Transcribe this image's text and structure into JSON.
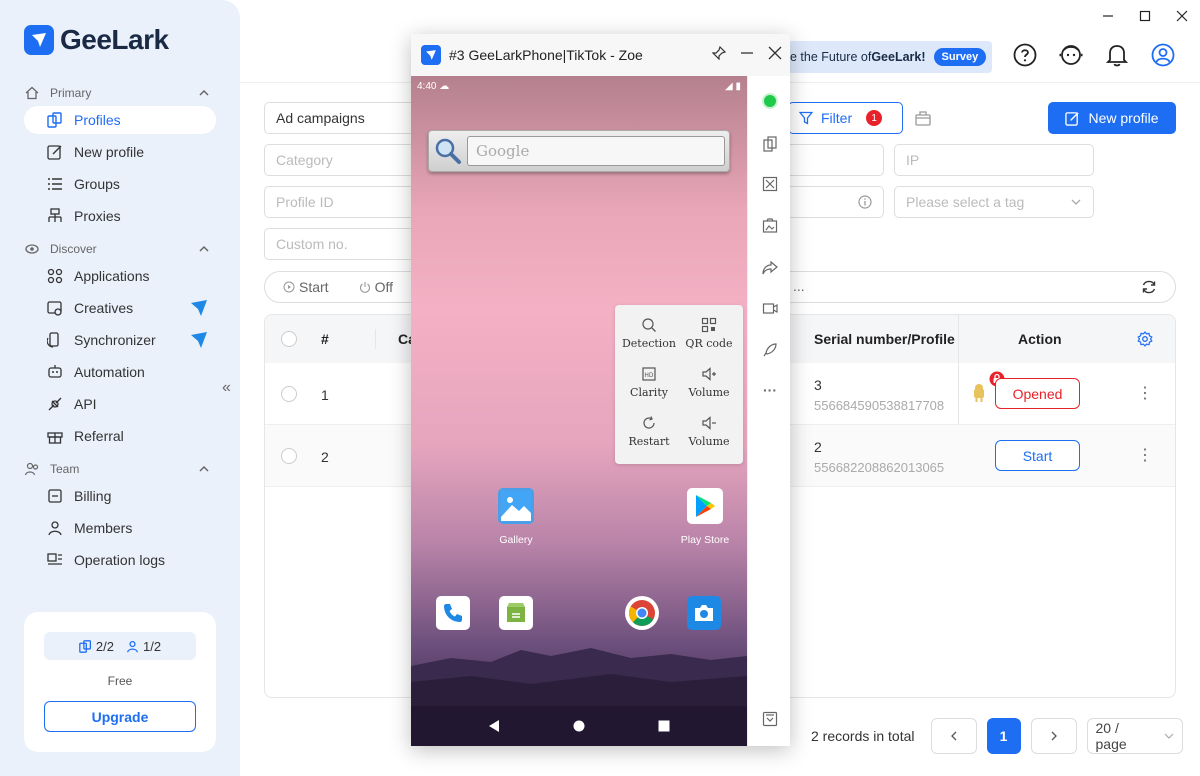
{
  "brand": {
    "name": "GeeLark"
  },
  "sidebar": {
    "sections": [
      {
        "label": "Primary"
      },
      {
        "label": "Discover"
      },
      {
        "label": "Team"
      }
    ],
    "items": [
      {
        "label": "Profiles",
        "icon": "profiles-icon",
        "active": true
      },
      {
        "label": "New profile",
        "icon": "edit-icon"
      },
      {
        "label": "Groups",
        "icon": "list-icon"
      },
      {
        "label": "Proxies",
        "icon": "network-icon"
      },
      {
        "label": "Applications",
        "icon": "grid-icon"
      },
      {
        "label": "Creatives",
        "icon": "creatives-icon"
      },
      {
        "label": "Synchronizer",
        "icon": "sync-icon"
      },
      {
        "label": "Automation",
        "icon": "robot-icon"
      },
      {
        "label": "API",
        "icon": "api-icon"
      },
      {
        "label": "Referral",
        "icon": "gift-icon"
      },
      {
        "label": "Billing",
        "icon": "billing-icon"
      },
      {
        "label": "Members",
        "icon": "person-icon"
      },
      {
        "label": "Operation logs",
        "icon": "logs-icon"
      }
    ],
    "plan": {
      "profiles": "2/2",
      "members": "1/2",
      "name": "Free",
      "upgrade_label": "Upgrade"
    }
  },
  "topbar": {
    "survey_text_pre": "e the Future of ",
    "survey_text_bold": "GeeLark!",
    "survey_button": "Survey"
  },
  "filters": {
    "ad_campaigns": "Ad campaigns",
    "category_placeholder": "Category",
    "profile_id_placeholder": "Profile ID",
    "custom_no_placeholder": "Custom no.",
    "ip_placeholder": "IP",
    "tag_placeholder": "Please select a tag",
    "filter_label": "Filter",
    "filter_count": "1",
    "new_profile_label": "New profile",
    "status_start": "Start",
    "status_off": "Off",
    "status_more": "..."
  },
  "table": {
    "headers": {
      "index": "#",
      "category_partial": "Ca",
      "serial": "Serial number/Profile",
      "action": "Action"
    },
    "rows": [
      {
        "index": "1",
        "serial": "3",
        "profile_id": "556684590538817708",
        "action": "Opened"
      },
      {
        "index": "2",
        "serial": "2",
        "profile_id": "556682208862013065",
        "action": "Start"
      }
    ]
  },
  "pagination": {
    "total": "2 records in total",
    "current": "1",
    "page_size": "20 / page"
  },
  "phone_window": {
    "title": "#3 GeeLarkPhone|TikTok - Zoe",
    "time": "4:40",
    "search_placeholder": "Google",
    "popup": [
      {
        "label": "Detection",
        "icon": "detection-icon"
      },
      {
        "label": "QR code",
        "icon": "qr-code-icon"
      },
      {
        "label": "Clarity",
        "icon": "clarity-icon"
      },
      {
        "label": "Volume",
        "icon": "volume-up-icon"
      },
      {
        "label": "Restart",
        "icon": "restart-icon"
      },
      {
        "label": "Volume",
        "icon": "volume-down-icon"
      }
    ],
    "apps": {
      "gallery": "Gallery",
      "play_store": "Play Store"
    }
  },
  "colors": {
    "accent": "#1e6ef4",
    "danger": "#e8222a",
    "sidebar_bg": "#eaf1fb"
  }
}
